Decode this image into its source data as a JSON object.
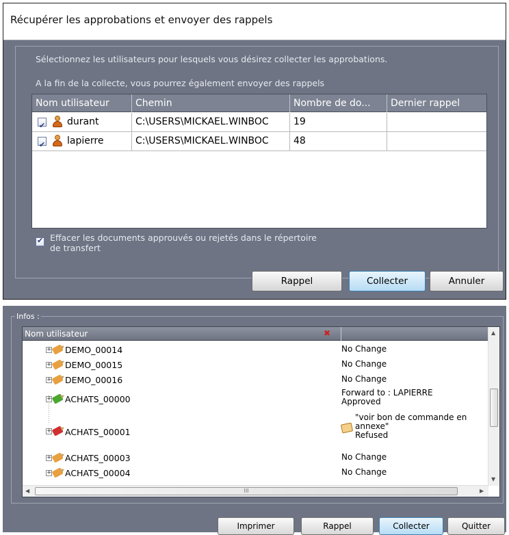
{
  "dialog_top": {
    "title": "Récupérer les approbations et envoyer des rappels",
    "instruction": "Sélectionnez les utilisateurs pour lesquels vous désirez collecter les approbations.",
    "note": "A la fin de la collecte, vous pourrez également envoyer des rappels",
    "columns": [
      "Nom utilisateur",
      "Chemin",
      "Nombre de do...",
      "Dernier rappel"
    ],
    "rows": [
      {
        "checked": true,
        "user": "durant",
        "path": "C:\\USERS\\MICKAEL.WINBOC",
        "count": "19",
        "last_reminder": ""
      },
      {
        "checked": true,
        "user": "lapierre",
        "path": "C:\\USERS\\MICKAEL.WINBOC",
        "count": "48",
        "last_reminder": ""
      }
    ],
    "delete_option_line1": "Effacer les documents approuvés ou rejetés dans le répertoire",
    "delete_option_line2": "de transfert",
    "buttons": {
      "rappel": "Rappel",
      "collecter": "Collecter",
      "annuler": "Annuler"
    }
  },
  "dialog_bottom": {
    "group_label": "Infos :",
    "column_user": "Nom utilisateur",
    "items": [
      {
        "name": "DEMO_00014",
        "status": [
          "No Change"
        ],
        "icon": "pencil-icon",
        "color": "#e8a040"
      },
      {
        "name": "DEMO_00015",
        "status": [
          "No Change"
        ],
        "icon": "pencil-icon",
        "color": "#e8a040"
      },
      {
        "name": "DEMO_00016",
        "status": [
          "No Change"
        ],
        "icon": "pencil-icon",
        "color": "#e8a040"
      },
      {
        "name": "ACHATS_00000",
        "status": [
          "Forward to : LAPIERRE",
          "Approved"
        ],
        "icon": "pencil-icon",
        "color": "#4aa830"
      },
      {
        "name": "ACHATS_00001",
        "status": [
          "\"voir bon de commande en",
          "annexe\"",
          "Refused"
        ],
        "icon": "pencil-icon",
        "color": "#d03030"
      },
      {
        "name": "ACHATS_00003",
        "status": [
          "No Change"
        ],
        "icon": "pencil-icon",
        "color": "#e8a040"
      },
      {
        "name": "ACHATS_00004",
        "status": [
          "No Change"
        ],
        "icon": "pencil-icon",
        "color": "#e8a040"
      }
    ],
    "scroll_mark": "III",
    "buttons": {
      "imprimer": "Imprimer",
      "rappel": "Rappel",
      "collecter": "Collecter",
      "quitter": "Quitter"
    }
  }
}
